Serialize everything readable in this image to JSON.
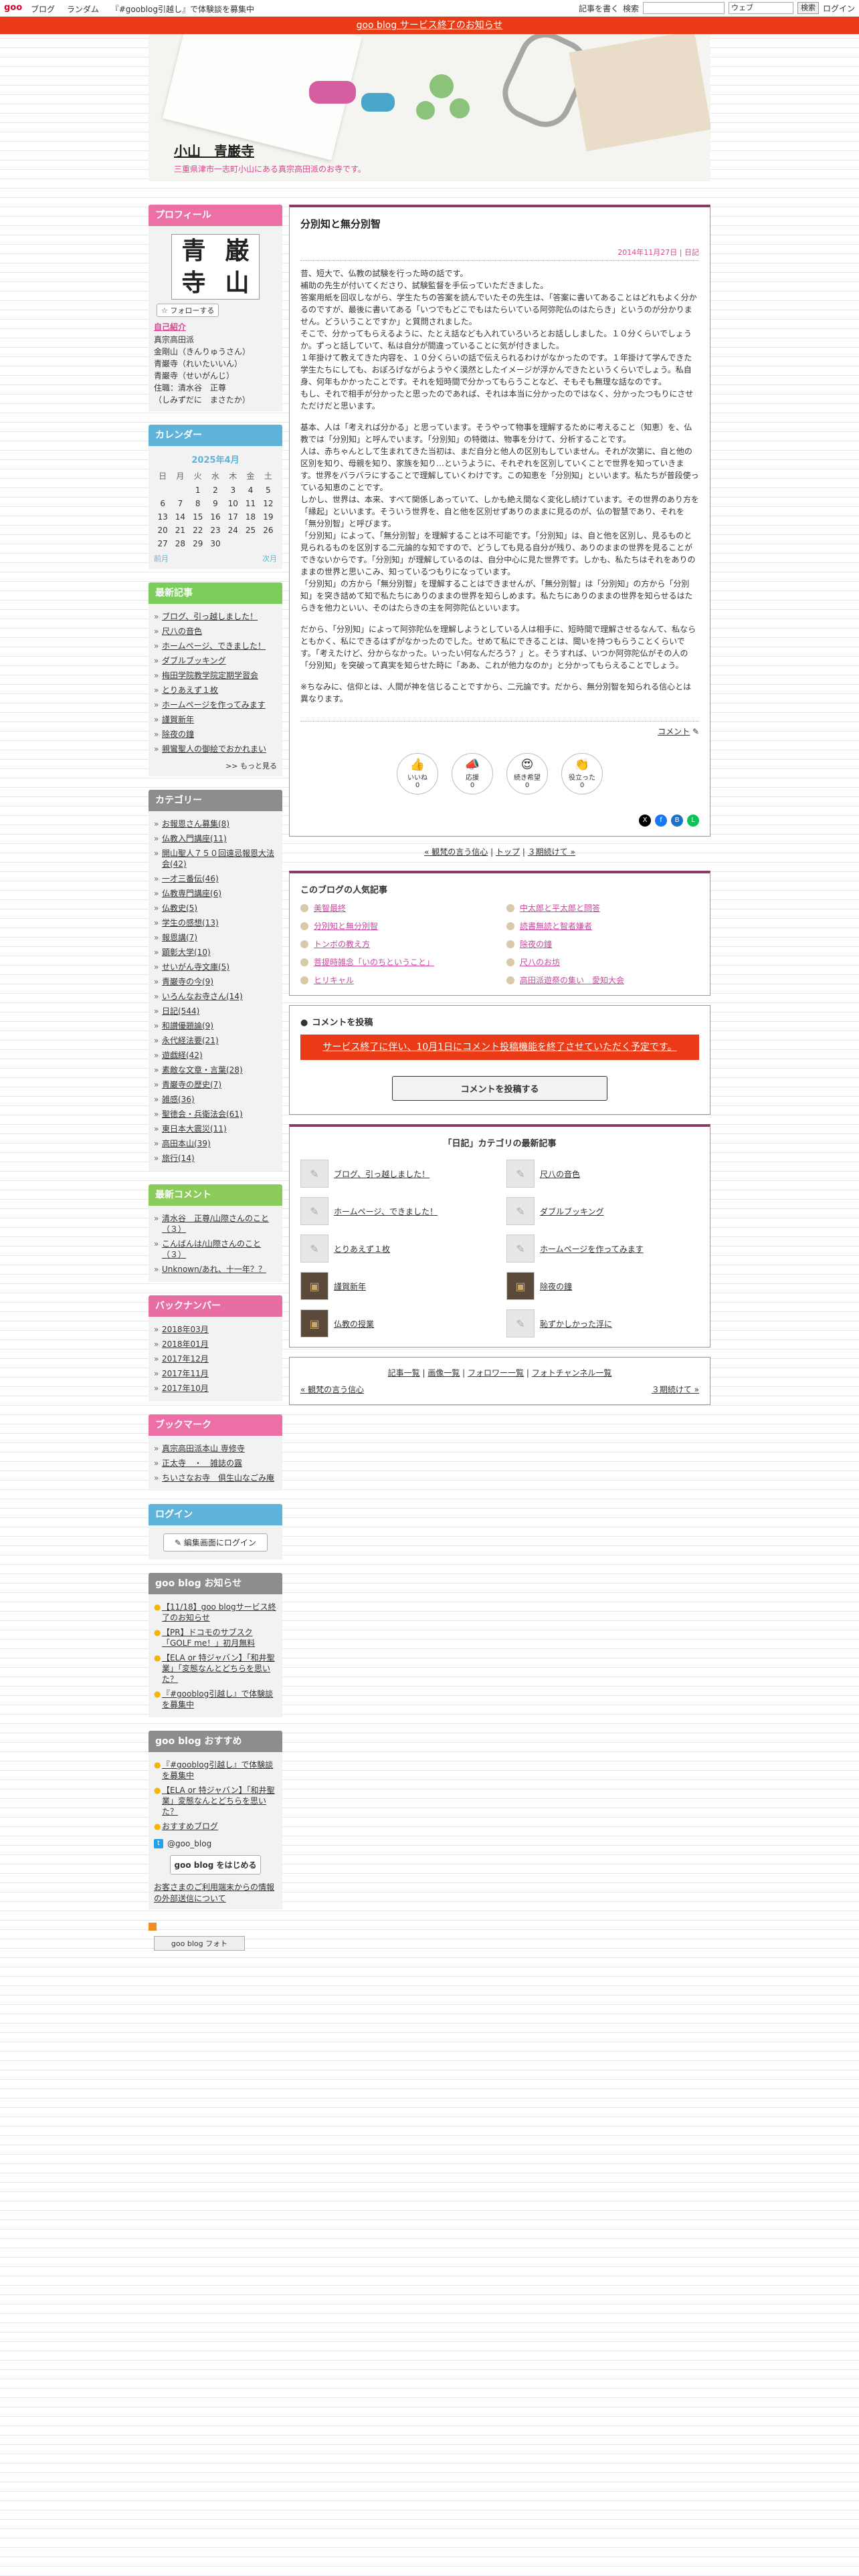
{
  "goo_bar": {
    "logo": "goo",
    "nav": [
      "ブログ",
      "ランダム",
      "『#gooblog引越し』で体験談を募集中"
    ],
    "write_label": "記事を書く",
    "search_label": "検索",
    "search_placeholder": "",
    "search_scope": "ウェブ",
    "search_button": "検索",
    "login_label": "ログイン"
  },
  "notice": "goo blog サービス終了のお知らせ",
  "blog": {
    "title": "小山　青巌寺",
    "subtitle": "三重県津市一志町小山にある真宗高田派のお寺です。"
  },
  "sidebar": {
    "profile": {
      "header": "プロフィール",
      "image_chars": [
        "青",
        "巌",
        "寺",
        "山"
      ],
      "follow": "フォローする",
      "intro_link": "自己紹介",
      "lines": [
        "真宗高田派",
        "金剛山（きんりゅうさん）",
        "青巌寺（れいたいいん）",
        "青巌寺（せいがんじ）",
        "",
        "住職：清水谷　正尊",
        "（しみずだに　まさたか）"
      ]
    },
    "calendar": {
      "header": "カレンダー",
      "month": "2025年4月",
      "weekdays": [
        "日",
        "月",
        "火",
        "水",
        "木",
        "金",
        "土"
      ],
      "weeks": [
        [
          "",
          "",
          "1",
          "2",
          "3",
          "4",
          "5"
        ],
        [
          "6",
          "7",
          "8",
          "9",
          "10",
          "11",
          "12"
        ],
        [
          "13",
          "14",
          "15",
          "16",
          "17",
          "18",
          "19"
        ],
        [
          "20",
          "21",
          "22",
          "23",
          "24",
          "25",
          "26"
        ],
        [
          "27",
          "28",
          "29",
          "30",
          "",
          "",
          ""
        ]
      ],
      "prev": "前月",
      "next": "次月"
    },
    "recent": {
      "header": "最新記事",
      "items": [
        "ブログ、引っ越しました！",
        "尺八の音色",
        "ホームページ、できました！",
        "ダブルブッキング",
        "梅田学院教学院定期学習会",
        "とりあえず１枚",
        "ホームページを作ってみます",
        "謹賀新年",
        "除夜の鐘",
        "親鸞聖人の御絵でおかれまい"
      ],
      "more": ">> もっと見る"
    },
    "category": {
      "header": "カテゴリー",
      "items": [
        "お報恩さん募集(8)",
        "仏教入門講座(11)",
        "開山聖人７５０回遠忌報恩大法会(42)",
        "一才三番伝(46)",
        "仏教専門講座(6)",
        "仏教史(5)",
        "学生の感想(13)",
        "報恩講(7)",
        "顕彰大学(10)",
        "せいがん寺文庫(5)",
        "青巌寺の今(9)",
        "いろんなお寺さん(14)",
        "日記(544)",
        "和讃優題論(9)",
        "永代経法要(21)",
        "遊戯経(42)",
        "素敵な文章・言葉(28)",
        "青巌寺の歴史(7)",
        "雑感(36)",
        "聖徳会・兵衛法会(61)",
        "東日本大震災(11)",
        "高田本山(39)",
        "旅行(14)"
      ]
    },
    "recent_comments": {
      "header": "最新コメント",
      "items": [
        "清水谷　正尊/山際さんのこと（３）",
        "こんばんは/山際さんのこと（３）",
        "Unknown/あれ、十一年？？"
      ]
    },
    "backnumber": {
      "header": "バックナンバー",
      "items": [
        "2018年03月",
        "2018年01月",
        "2017年12月",
        "2017年11月",
        "2017年10月"
      ]
    },
    "bookmark": {
      "header": "ブックマーク",
      "items": [
        "真宗高田派本山 専修寺",
        "正太寺　・　雑誌の露",
        "ちいさなお寺　俱生山なごみ庵"
      ]
    },
    "login": {
      "header": "ログイン",
      "button": "編集画面にログイン"
    },
    "goo_news": {
      "header": "goo blog お知らせ",
      "items": [
        "【11/18】goo blogサービス終了のお知らせ",
        "【PR】ドコモのサブスク「GOLF me！」初月無料",
        "【ELA or 特ジャバン】「和井聖業」「変態なんとどちらを思いた？",
        "『#gooblog引越し』で体験談を募集中"
      ]
    },
    "goo_recommend": {
      "header": "goo blog おすすめ",
      "items": [
        "『#gooblog引越し』で体験談を募集中",
        "【ELA or 特ジャバン】「和井聖業」変態なんとどちらを思いた？",
        "おすすめブログ"
      ],
      "twitter": "@goo_blog",
      "start_button": "goo blog をはじめる",
      "info_link": "お客さまのご利用端末からの情報の外部送信について",
      "photo_button": "goo blog フォト"
    }
  },
  "article": {
    "title": "分別知と無分別智",
    "date": "2014年11月27日",
    "category": "日記",
    "paragraphs": [
      "昔、短大で、仏教の試験を行った時の話です。\n補助の先生が付いてくださり、試験監督を手伝っていただきました。\n答案用紙を回収しながら、学生たちの答案を読んでいたその先生は、「答案に書いてあることはどれもよく分かるのですが、最後に書いてある「いつでもどこでもはたらいている阿弥陀仏のはたらき」というのが分かりません。どういうことですか」と質問されました。\nそこで、分かってもらえるように、たとえ話なども入れていろいろとお話ししました。１０分くらいでしょうか。ずっと話していて、私は自分が間違っていることに気が付きました。\n１年掛けて教えてきた内容を、１０分くらいの話で伝えられるわけがなかったのです。１年掛けて学んできた学生たちにしても、おぼろげながらようやく漠然としたイメージが浮かんできたというくらいでしょう。私自身、何年もかかったことです。それを短時間で分かってもらうことなど、そもそも無理な話なのです。\nもし、それで相手が分かったと思ったのであれば、それは本当に分かったのではなく、分かったつもりにさせただけだと思います。",
      "基本、人は「考えれば分かる」と思っています。そうやって物事を理解するために考えること（知恵）を、仏教では「分別知」と呼んでいます。「分別知」の特徴は、物事を分けて、分析することです。\n人は、赤ちゃんとして生まれてきた当初は、まだ自分と他人の区別もしていません。それが次第に、自と他の区別を知り、母親を知り、家族を知り…というように、それぞれを区別していくことで世界を知っていきます。世界をバラバラにすることで理解していくわけです。この知恵を「分別知」といいます。私たちが普段使っている知恵のことです。\nしかし、世界は、本来、すべて関係しあっていて、しかも絶え間なく変化し続けています。その世界のあり方を「縁起」といいます。そういう世界を、自と他を区別せずありのままに見るのが、仏の智慧であり、それを「無分別智」と呼びます。\n「分別知」によって、「無分別智」を理解することは不可能です。「分別知」は、自と他を区別し、見るものと見られるものを区別する二元論的な知ですので、どうしても見る自分が残り、ありのままの世界を見ることができないからです。「分別知」が理解しているのは、自分中心に見た世界です。しかも、私たちはそれをありのままの世界と思いこみ、知っているつもりになっています。\n「分別知」の方から「無分別智」を理解することはできませんが、「無分別智」は「分別知」の方から「分別知」を突き詰めて知で私たちにありのままの世界を知らしめます。私たちにありのままの世界を知らせるはたらきを他力といい、そのはたらきの主を阿弥陀仏といいます。",
      "だから、「分別知」によって阿弥陀仏を理解しようとしている人は相手に、短時間で理解させるなんて、私ならともかく、私にできるはずがなかったのでした。せめて私にできることは、聞いを持つもらうことくらいです。「考えたけど、分からなかった。いったい何なんだろう？」と。そうすれば、いつか阿弥陀仏がその人の「分別知」を突破って真実を知らせた時に「ああ、これが他力なのか」と分かってもらえることでしょう。",
      "※ちなみに、信仰とは、人間が神を信じることですから、二元論です。だから、無分別智を知られる信心とは異なります。"
    ],
    "comment_link": "コメント",
    "reactions": [
      {
        "emo": "👍",
        "label": "いいね",
        "count": "0"
      },
      {
        "emo": "📣",
        "label": "応援",
        "count": "0"
      },
      {
        "emo": "😍",
        "label": "続き希望",
        "count": "0"
      },
      {
        "emo": "👏",
        "label": "役立った",
        "count": "0"
      }
    ]
  },
  "pager": {
    "prev": "« 観梵の言う信心",
    "top": "トップ",
    "next": "３期続けて »"
  },
  "popular": {
    "title": "このブログの人気記事",
    "items": [
      "美智最終",
      "分別知と無分別智",
      "トンボの教え方",
      "菩提時雑念「いのちということ」",
      "ヒリキャル",
      "中太郎と平太郎と問答",
      "読書無読と智者嫌者",
      "除夜の鐘",
      "尺八のお坊",
      "高田派遊祭の集い　愛知大会"
    ]
  },
  "comment": {
    "header": "コメントを投稿",
    "alert": "サービス終了に伴い、10月1日にコメント投稿機能を終了させていただく予定です。",
    "button": "コメントを投稿する"
  },
  "category_latest": {
    "title": "「日記」カテゴリの最新記事",
    "items": [
      {
        "label": "ブログ、引っ越しました！",
        "photo": false
      },
      {
        "label": "尺八の音色",
        "photo": false
      },
      {
        "label": "ホームページ、できました！",
        "photo": false
      },
      {
        "label": "ダブルブッキング",
        "photo": false
      },
      {
        "label": "とりあえず１枚",
        "photo": false
      },
      {
        "label": "ホームページを作ってみます",
        "photo": false
      },
      {
        "label": "謹賀新年",
        "photo": true
      },
      {
        "label": "除夜の鐘",
        "photo": true
      },
      {
        "label": "仏教の授業",
        "photo": true
      },
      {
        "label": "恥ずかしかった浮に",
        "photo": false
      }
    ]
  },
  "footer": {
    "links": [
      "記事一覧",
      "画像一覧",
      "フォロワー一覧",
      "フォトチャンネル一覧"
    ],
    "prev": "« 観梵の言う信心",
    "next": "３期続けて »"
  }
}
